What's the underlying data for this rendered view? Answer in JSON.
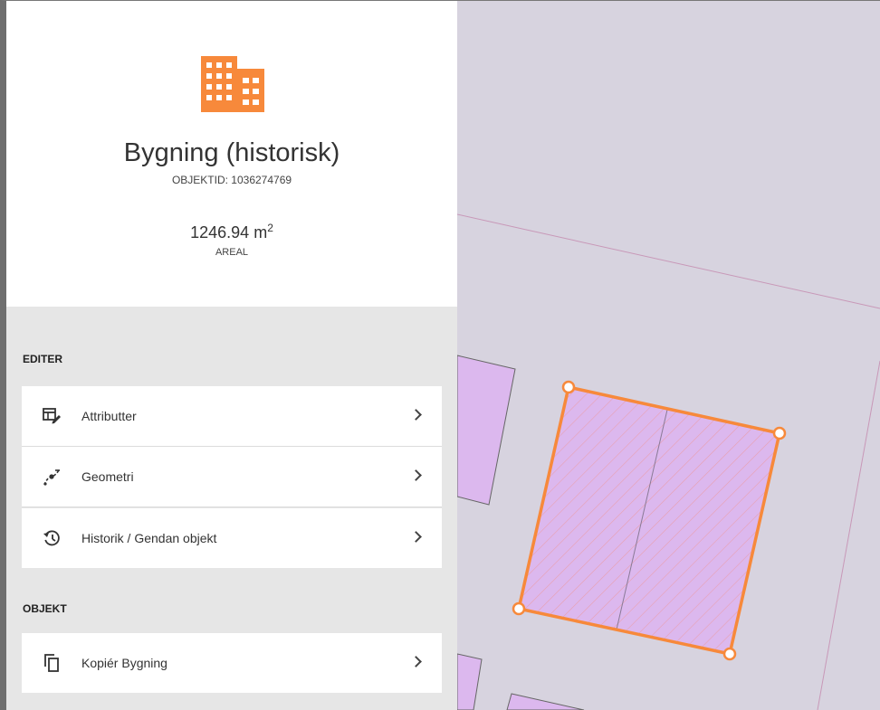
{
  "feature": {
    "icon": "building-icon",
    "title": "Bygning (historisk)",
    "object_id": "OBJEKTID: 1036274769",
    "area_value": "1246.94 m",
    "area_unit_exp": "2",
    "area_label": "AREAL"
  },
  "sections": {
    "edit": {
      "heading": "EDITER",
      "items": [
        {
          "label": "Attributter",
          "icon": "attributes-edit-icon"
        },
        {
          "label": "Geometri",
          "icon": "geometry-edit-icon"
        },
        {
          "label": "Historik / Gendan objekt",
          "icon": "history-restore-icon"
        }
      ]
    },
    "object": {
      "heading": "OBJEKT",
      "items": [
        {
          "label": "Kopiér Bygning",
          "icon": "copy-icon"
        }
      ]
    }
  },
  "colors": {
    "accent": "#f7893b",
    "map_background": "#d7d3df",
    "building_fill": "#dcb8ee"
  }
}
